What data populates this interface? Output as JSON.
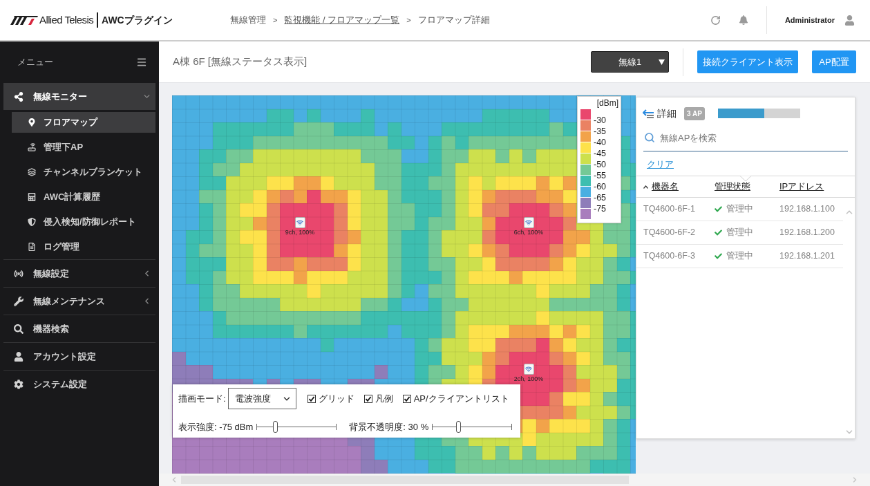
{
  "header": {
    "logo": {
      "brand": "Allied Telesis",
      "product": "AWCプラグイン"
    },
    "breadcrumb": [
      {
        "kind": "text",
        "label": "無線管理"
      },
      {
        "kind": "separator",
        "label": ">"
      },
      {
        "kind": "link",
        "label": "監視機能 / フロアマップ一覧"
      },
      {
        "kind": "separator",
        "label": ">"
      },
      {
        "kind": "text",
        "label": "フロアマップ詳細"
      }
    ],
    "user": "Administrator"
  },
  "sidebar": {
    "title": "メニュー",
    "items": [
      {
        "label": "無線モニター",
        "selected": true,
        "expanded": true,
        "children": [
          {
            "label": "フロアマップ",
            "selected": true
          },
          {
            "label": "管理下AP",
            "selected": false
          },
          {
            "label": "チャンネルブランケット",
            "selected": false
          },
          {
            "label": "AWC計算履歴",
            "selected": false
          },
          {
            "label": "侵入検知/防御レポート",
            "selected": false
          },
          {
            "label": "ログ管理",
            "selected": false
          }
        ]
      },
      {
        "label": "無線設定",
        "selected": false,
        "expanded": false
      },
      {
        "label": "無線メンテナンス",
        "selected": false,
        "expanded": false
      },
      {
        "label": "機器検索",
        "selected": false
      },
      {
        "label": "アカウント設定",
        "selected": false
      },
      {
        "label": "システム設定",
        "selected": false
      }
    ]
  },
  "toolbar": {
    "title": "A棟 6F [無線ステータス表示]",
    "radio_select": "無線1",
    "buttons": [
      "接続クライアント表示",
      "AP配置"
    ]
  },
  "map": {
    "access_points": [
      {
        "label": "9ch, 100%"
      },
      {
        "label": "6ch, 100%"
      },
      {
        "label": "2ch, 100%"
      }
    ],
    "legend": {
      "unit": "[dBm]",
      "labels": [
        "-30",
        "-35",
        "-40",
        "-45",
        "-50",
        "-55",
        "-60",
        "-65",
        "-75"
      ],
      "swatches": [
        {
          "color": "#e9476d"
        },
        {
          "color": "#ea8263"
        },
        {
          "color": "#f2a34a"
        },
        {
          "color": "#fde24b"
        },
        {
          "color": "#cde04d"
        },
        {
          "color": "#74c996"
        },
        {
          "color": "#3dbeb0"
        },
        {
          "color": "#4aafe1"
        },
        {
          "color": "#8e7db9"
        },
        {
          "color": "#a97dbd"
        }
      ]
    }
  },
  "controls": {
    "draw_mode": {
      "label": "描画モード:",
      "value": "電波強度"
    },
    "checkboxes": [
      {
        "label": "グリッド",
        "checked": true
      },
      {
        "label": "凡例",
        "checked": true
      },
      {
        "label": "AP/クライアントリスト",
        "checked": true
      }
    ],
    "sliders": [
      {
        "label": "表示強度: -75 dBm",
        "level": 0.23
      },
      {
        "label": "背景不透明度: 30 %",
        "level": 0.33
      }
    ]
  },
  "panel": {
    "title": "詳細",
    "badge": "3 AP",
    "progress": {
      "level": 0.56
    },
    "search": {
      "placeholder": "無線APを検索"
    },
    "clear_link": "クリア",
    "columns": [
      {
        "label": "機器名",
        "sorted": true
      },
      {
        "label": "管理状態",
        "sorted": false
      },
      {
        "label": "IPアドレス",
        "sorted": false
      }
    ],
    "rows": [
      {
        "name": "TQ4600-6F-1",
        "status": "管理中",
        "ip": "192.168.1.100"
      },
      {
        "name": "TQ4600-6F-2",
        "status": "管理中",
        "ip": "192.168.1.200"
      },
      {
        "name": "TQ4600-6F-3",
        "status": "管理中",
        "ip": "192.168.1.201"
      }
    ]
  }
}
